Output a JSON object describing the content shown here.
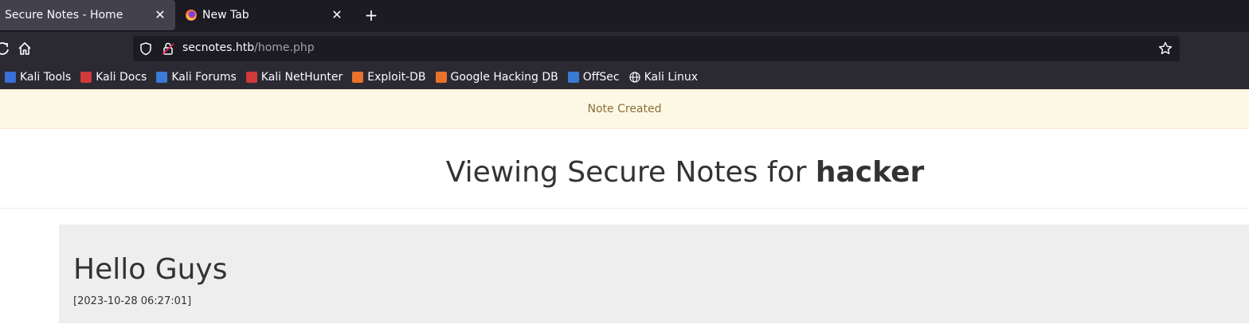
{
  "browser": {
    "tabs": [
      {
        "title": "Secure Notes - Home",
        "active": true
      },
      {
        "title": "New Tab",
        "active": false
      }
    ],
    "url": {
      "host": "secnotes.htb",
      "path": "/home.php"
    },
    "bookmarks": [
      {
        "label": "Kali Tools",
        "icon": "kali-tools-icon",
        "color": "#3b6fd8"
      },
      {
        "label": "Kali Docs",
        "icon": "kali-docs-icon",
        "color": "#d03a3a"
      },
      {
        "label": "Kali Forums",
        "icon": "kali-forums-icon",
        "color": "#3a7bd5"
      },
      {
        "label": "Kali NetHunter",
        "icon": "kali-nethunter-icon",
        "color": "#d03a3a"
      },
      {
        "label": "Exploit-DB",
        "icon": "exploit-db-icon",
        "color": "#e8712b"
      },
      {
        "label": "Google Hacking DB",
        "icon": "google-hacking-db-icon",
        "color": "#e8712b"
      },
      {
        "label": "OffSec",
        "icon": "offsec-icon",
        "color": "#3a7bd5"
      },
      {
        "label": "Kali Linux",
        "icon": "globe-icon",
        "color": "#fbfbfe"
      }
    ]
  },
  "alert": {
    "message": "Note Created"
  },
  "header": {
    "prefix": "Viewing Secure Notes for ",
    "username": "hacker"
  },
  "notes": [
    {
      "title": "Hello Guys",
      "date": "[2023-10-28 06:27:01]"
    }
  ]
}
